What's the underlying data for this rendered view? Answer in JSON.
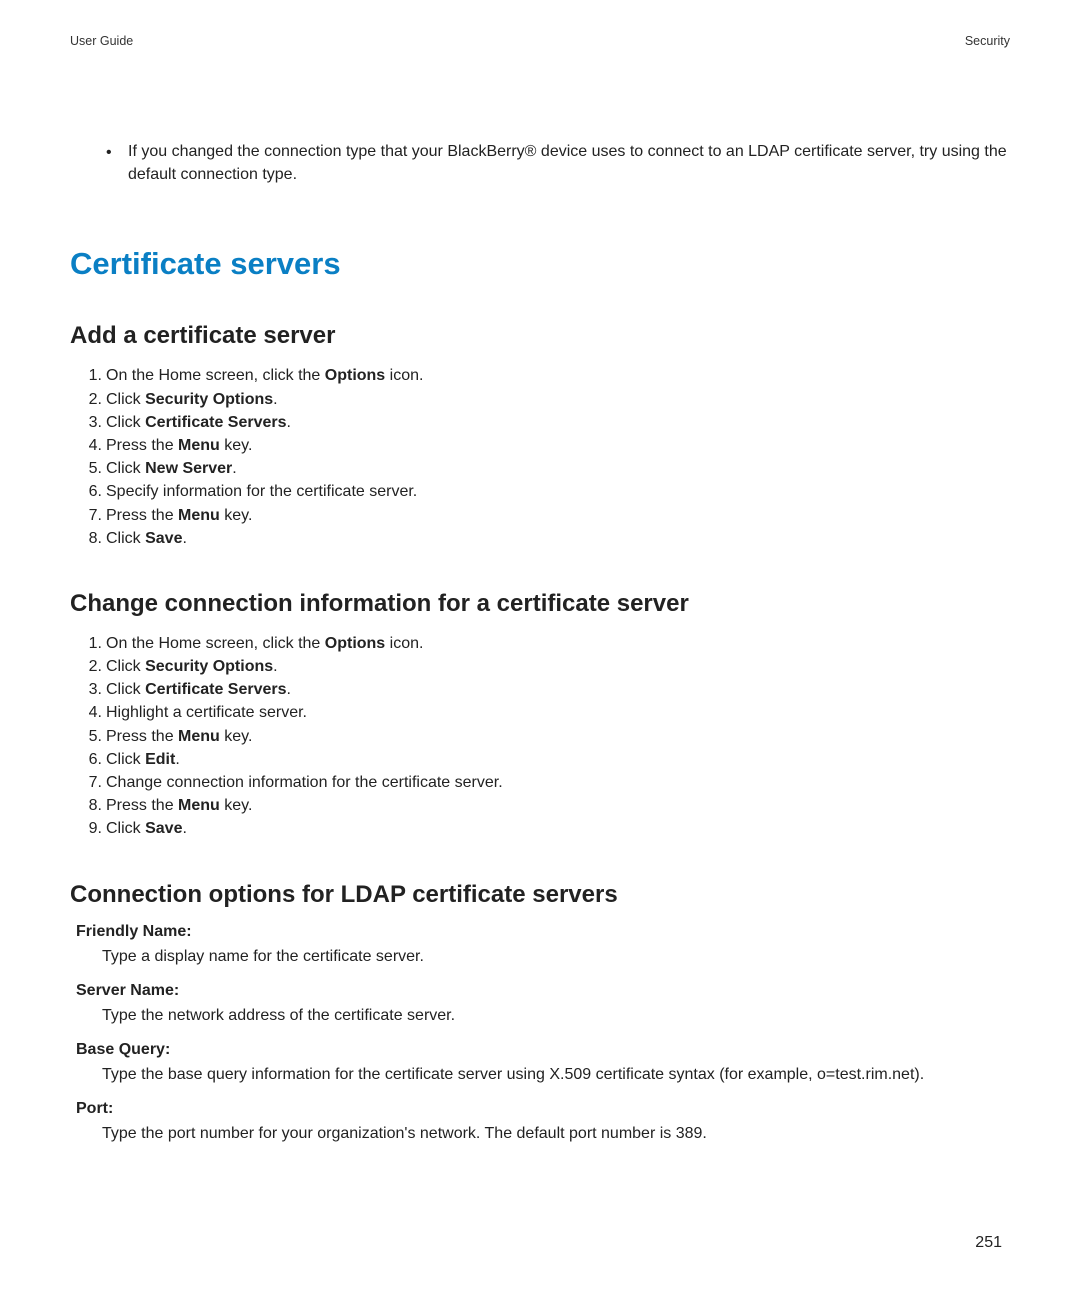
{
  "header": {
    "left": "User Guide",
    "right": "Security"
  },
  "intro_bullet": {
    "text": "If you changed the connection type that your BlackBerry® device uses to connect to an LDAP certificate server, try using the default connection type."
  },
  "h1": "Certificate servers",
  "section_add": {
    "title": "Add a certificate server",
    "steps": [
      {
        "pre": "On the Home screen, click the ",
        "bold": "Options",
        "post": " icon."
      },
      {
        "pre": "Click ",
        "bold": "Security Options",
        "post": "."
      },
      {
        "pre": "Click ",
        "bold": "Certificate Servers",
        "post": "."
      },
      {
        "pre": "Press the ",
        "bold": "Menu",
        "post": " key."
      },
      {
        "pre": "Click ",
        "bold": "New Server",
        "post": "."
      },
      {
        "pre": "Specify information for the certificate server.",
        "bold": "",
        "post": ""
      },
      {
        "pre": "Press the ",
        "bold": "Menu",
        "post": " key."
      },
      {
        "pre": "Click ",
        "bold": "Save",
        "post": "."
      }
    ]
  },
  "section_change": {
    "title": "Change connection information for a certificate server",
    "steps": [
      {
        "pre": "On the Home screen, click the ",
        "bold": "Options",
        "post": " icon."
      },
      {
        "pre": "Click ",
        "bold": "Security Options",
        "post": "."
      },
      {
        "pre": "Click ",
        "bold": "Certificate Servers",
        "post": "."
      },
      {
        "pre": "Highlight a certificate server.",
        "bold": "",
        "post": ""
      },
      {
        "pre": "Press the ",
        "bold": "Menu",
        "post": " key."
      },
      {
        "pre": "Click ",
        "bold": "Edit",
        "post": "."
      },
      {
        "pre": "Change connection information for the certificate server.",
        "bold": "",
        "post": ""
      },
      {
        "pre": "Press the ",
        "bold": "Menu",
        "post": " key."
      },
      {
        "pre": "Click ",
        "bold": "Save",
        "post": "."
      }
    ]
  },
  "section_options": {
    "title": "Connection options for LDAP certificate servers",
    "items": [
      {
        "term": "Friendly Name:",
        "def": "Type a display name for the certificate server."
      },
      {
        "term": "Server Name:",
        "def": "Type the network address of the certificate server."
      },
      {
        "term": "Base Query:",
        "def": "Type the base query information for the certificate server using X.509 certificate syntax (for example, o=test.rim.net)."
      },
      {
        "term": "Port:",
        "def": "Type the port number for your organization's network. The default port number is 389."
      }
    ]
  },
  "page_number": "251"
}
